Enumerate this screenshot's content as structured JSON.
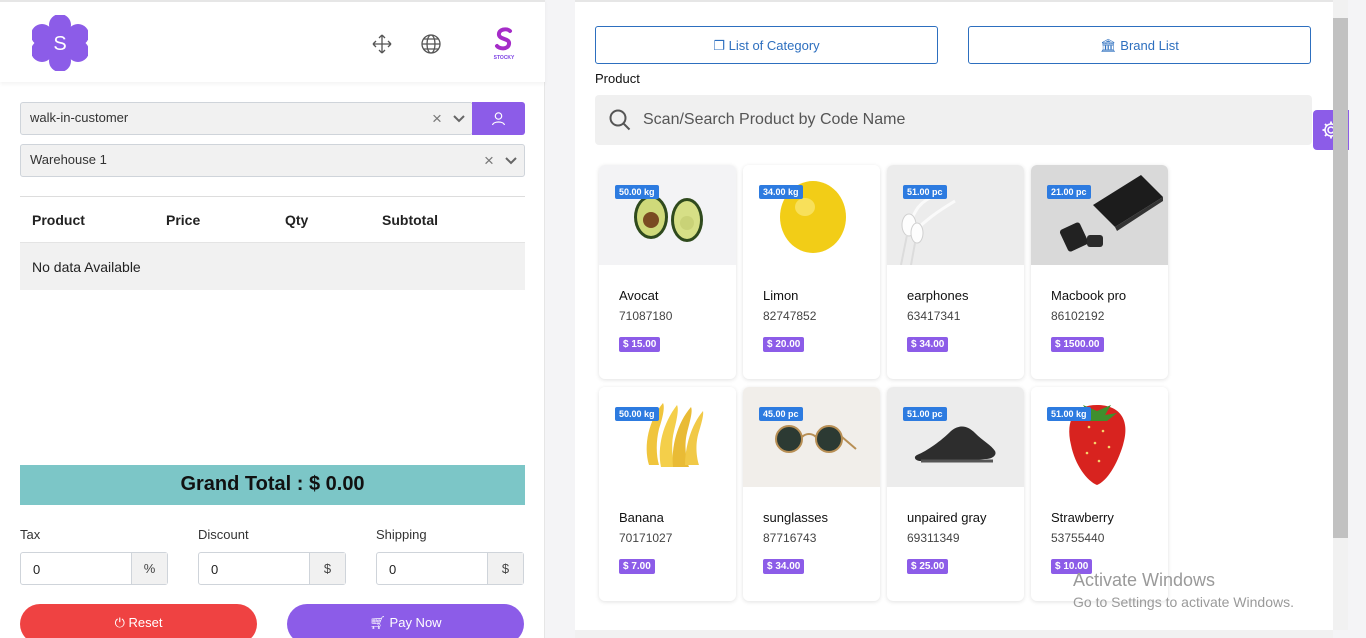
{
  "header": {
    "logo_letter": "S",
    "brand_badge": "STOCKY",
    "icons": [
      "fullscreen-icon",
      "globe-icon"
    ]
  },
  "customer": {
    "value": "walk-in-customer",
    "clear": "×"
  },
  "warehouse": {
    "value": "Warehouse 1",
    "clear": "×"
  },
  "cart": {
    "headers": [
      "Product",
      "Price",
      "Qty",
      "Subtotal"
    ],
    "empty_text": "No data Available"
  },
  "grand_total": "Grand Total : $ 0.00",
  "fields": {
    "tax": {
      "label": "Tax",
      "value": "0",
      "unit": "%"
    },
    "discount": {
      "label": "Discount",
      "value": "0",
      "unit": "$"
    },
    "shipping": {
      "label": "Shipping",
      "value": "0",
      "unit": "$"
    }
  },
  "buttons": {
    "reset": "Reset",
    "pay": "Pay Now"
  },
  "right": {
    "category_button": "List of Category",
    "brand_button": "Brand List",
    "product_label": "Product",
    "search_placeholder": "Scan/Search Product by Code Name"
  },
  "products": [
    {
      "name": "Avocat",
      "code": "71087180",
      "qty": "50.00 kg",
      "price": "$ 15.00"
    },
    {
      "name": "Limon",
      "code": "82747852",
      "qty": "34.00 kg",
      "price": "$ 20.00"
    },
    {
      "name": "earphones",
      "code": "63417341",
      "qty": "51.00 pc",
      "price": "$ 34.00"
    },
    {
      "name": "Macbook pro",
      "code": "86102192",
      "qty": "21.00 pc",
      "price": "$ 1500.00"
    },
    {
      "name": "Banana",
      "code": "70171027",
      "qty": "50.00 kg",
      "price": "$ 7.00"
    },
    {
      "name": "sunglasses",
      "code": "87716743",
      "qty": "45.00 pc",
      "price": "$ 34.00"
    },
    {
      "name": "unpaired gray",
      "code": "69311349",
      "qty": "51.00 pc",
      "price": "$ 25.00"
    },
    {
      "name": "Strawberry",
      "code": "53755440",
      "qty": "51.00 kg",
      "price": "$ 10.00"
    }
  ],
  "watermark": {
    "line1": "Activate Windows",
    "line2": "Go to Settings to activate Windows."
  },
  "colors": {
    "accent": "#8c5ce8",
    "grand_total_bg": "#7cc6c7",
    "reset": "#ef4242",
    "qty_badge": "#2d7be0"
  }
}
